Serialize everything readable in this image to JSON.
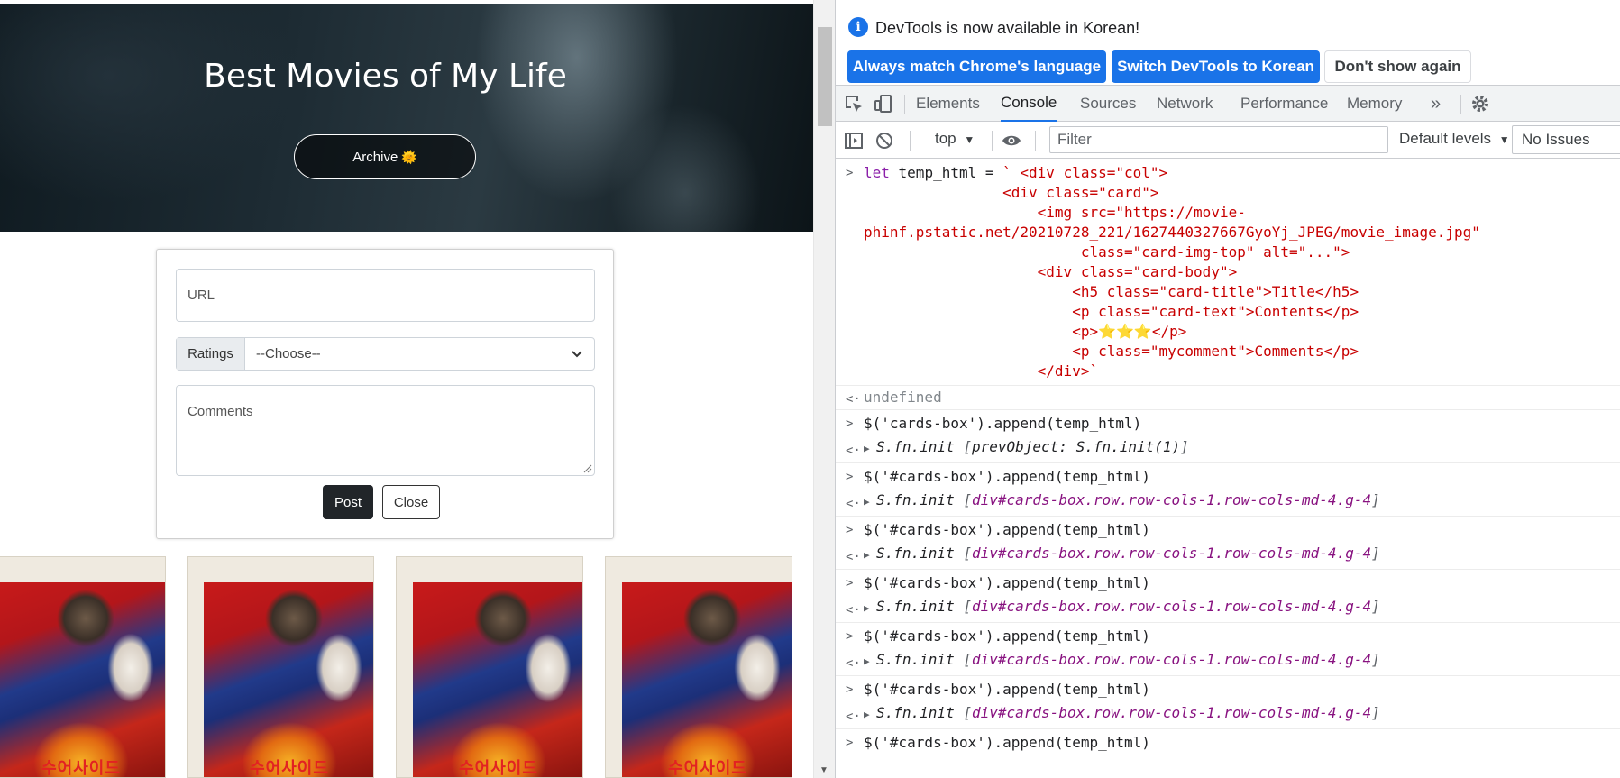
{
  "page": {
    "hero_title": "Best Movies of My Life",
    "archive_label": "Archive",
    "archive_emoji": "🌞",
    "form": {
      "url_placeholder": "URL",
      "ratings_label": "Ratings",
      "ratings_selected": "--Choose--",
      "comments_placeholder": "Comments",
      "post_label": "Post",
      "close_label": "Close"
    },
    "cards": [
      {
        "poster_text": "수어사이드"
      },
      {
        "poster_text": "수어사이드"
      },
      {
        "poster_text": "수어사이드"
      },
      {
        "poster_text": "수어사이드"
      }
    ]
  },
  "devtools": {
    "infobar": {
      "message": "DevTools is now available in Korean!",
      "btn_match": "Always match Chrome's language",
      "btn_korean": "Switch DevTools to Korean",
      "btn_dont": "Don't show again"
    },
    "tabs": [
      "Elements",
      "Console",
      "Sources",
      "Network",
      "Performance",
      "Memory"
    ],
    "active_tab": "Console",
    "filterbar": {
      "context": "top",
      "filter_placeholder": "Filter",
      "levels": "Default levels",
      "issues": "No Issues"
    },
    "console": {
      "first_command_lines": [
        "let temp_html = ` <div class=\"col\">",
        "                <div class=\"card\">",
        "                    <img src=\"https://movie-",
        "phinf.pstatic.net/20210728_221/1627440327667GyoYj_JPEG/movie_image.jpg\"",
        "                         class=\"card-img-top\" alt=\"...\">",
        "                    <div class=\"card-body\">",
        "                        <h5 class=\"card-title\">Title</h5>",
        "                        <p class=\"card-text\">Contents</p>",
        "                        <p>⭐⭐⭐</p>",
        "                        <p class=\"mycomment\">Comments</p>",
        "                    </div>`"
      ],
      "first_result": "undefined",
      "entries": [
        {
          "command": "$('cards-box').append(temp_html)",
          "result_fn": "S.fn.init",
          "result_detail": "prevObject: S.fn.init(1)"
        },
        {
          "command": "$('#cards-box').append(temp_html)",
          "result_fn": "S.fn.init",
          "result_detail": "div#cards-box.row.row-cols-1.row-cols-md-4.g-4"
        },
        {
          "command": "$('#cards-box').append(temp_html)",
          "result_fn": "S.fn.init",
          "result_detail": "div#cards-box.row.row-cols-1.row-cols-md-4.g-4"
        },
        {
          "command": "$('#cards-box').append(temp_html)",
          "result_fn": "S.fn.init",
          "result_detail": "div#cards-box.row.row-cols-1.row-cols-md-4.g-4"
        },
        {
          "command": "$('#cards-box').append(temp_html)",
          "result_fn": "S.fn.init",
          "result_detail": "div#cards-box.row.row-cols-1.row-cols-md-4.g-4"
        },
        {
          "command": "$('#cards-box').append(temp_html)",
          "result_fn": "S.fn.init",
          "result_detail": "div#cards-box.row.row-cols-1.row-cols-md-4.g-4"
        }
      ],
      "last_command": "$('#cards-box').append(temp_html)"
    }
  },
  "colors": {
    "accent": "#1a73e8",
    "string_red": "#c80000",
    "keyword_purple": "#8b1fa9"
  }
}
